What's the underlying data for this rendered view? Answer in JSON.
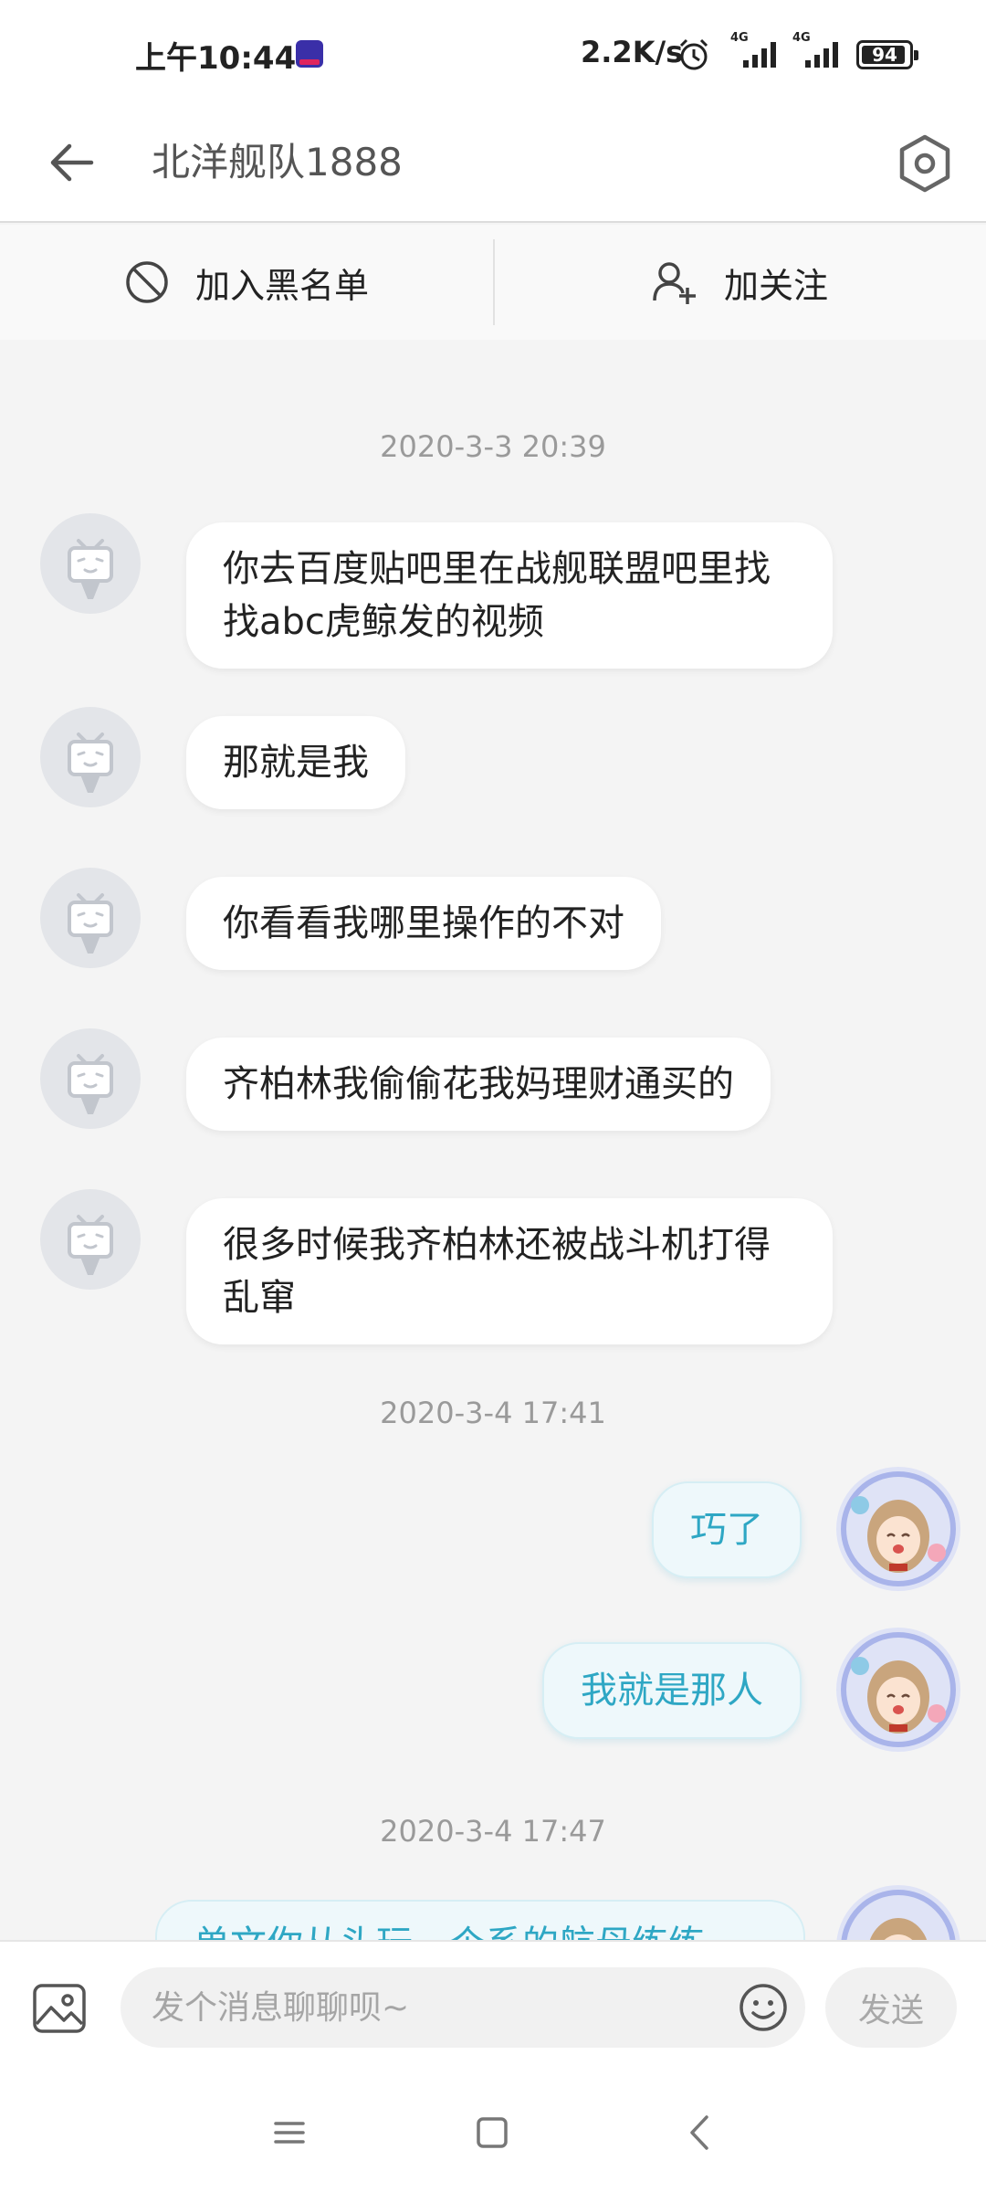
{
  "status_bar": {
    "time": "上午10:44",
    "net_speed": "2.2K/s",
    "network_1": "4G",
    "network_2": "4G",
    "battery": "94",
    "battery_level": 0.94,
    "icons": [
      "app-notification-icon",
      "alarm-icon",
      "signal-icon",
      "signal-icon",
      "battery-icon"
    ]
  },
  "header": {
    "title": "北洋舰队1888",
    "back_icon": "arrow-left-icon",
    "settings_icon": "hexagon-settings-icon"
  },
  "actions": {
    "block_label": "加入黑名单",
    "follow_label": "加关注"
  },
  "chat": {
    "timestamps": [
      "2020-3-3 20:39",
      "2020-3-4 17:41",
      "2020-3-4 17:47"
    ],
    "messages_left": [
      "你去百度贴吧里在战舰联盟吧里找找abc虎鲸发的视频",
      "那就是我",
      "你看看我哪里操作的不对",
      "齐柏林我偷偷花我妈理财通买的",
      "很多时候我齐柏林还被战斗机打得乱窜"
    ],
    "messages_right": [
      "巧了",
      "我就是那人"
    ],
    "partial_message": "单文你从头玩一个系的航母练练"
  },
  "input": {
    "placeholder": "发个消息聊聊呗~",
    "send_label": "发送"
  },
  "colors": {
    "accent_text": "#2ea7c4",
    "bubble_right_bg": "#eef8fb",
    "background": "#f4f4f4"
  }
}
